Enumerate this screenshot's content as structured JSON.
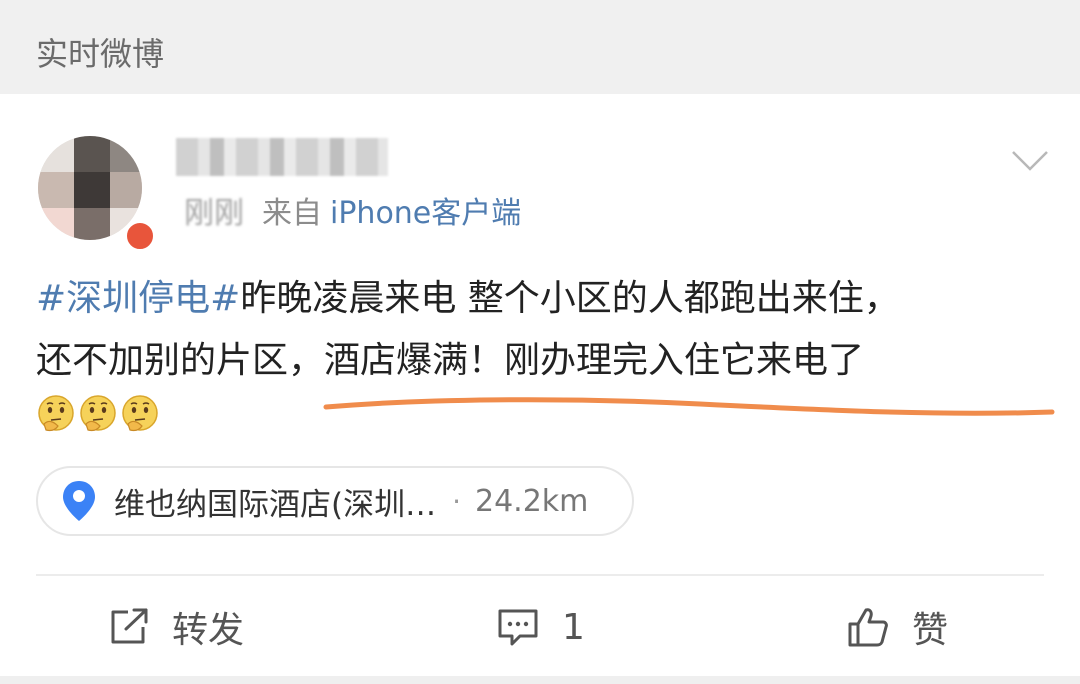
{
  "section": {
    "title": "实时微博"
  },
  "post": {
    "time": "刚刚",
    "from_prefix": "来自",
    "client": "iPhone客户端",
    "hashtag": "#深圳停电#",
    "text_line1_rest": "昨晚凌晨来电 整个小区的人都跑出来住，",
    "text_line2": "还不加别的片区，酒店爆满！刚办理完入住它来电了",
    "emojis": [
      "thinking-face-emoji",
      "thinking-face-emoji",
      "thinking-face-emoji"
    ],
    "location": {
      "name": "维也纳国际酒店(深圳…",
      "separator": "·",
      "distance": "24.2km"
    },
    "actions": {
      "repost_label": "转发",
      "comment_count": "1",
      "like_label": "赞"
    }
  },
  "colors": {
    "accent_link": "#4f7cb0",
    "underline_annotation": "#f08c4c",
    "location_pin": "#3b82f6",
    "header_bg": "#f0f0f0"
  }
}
